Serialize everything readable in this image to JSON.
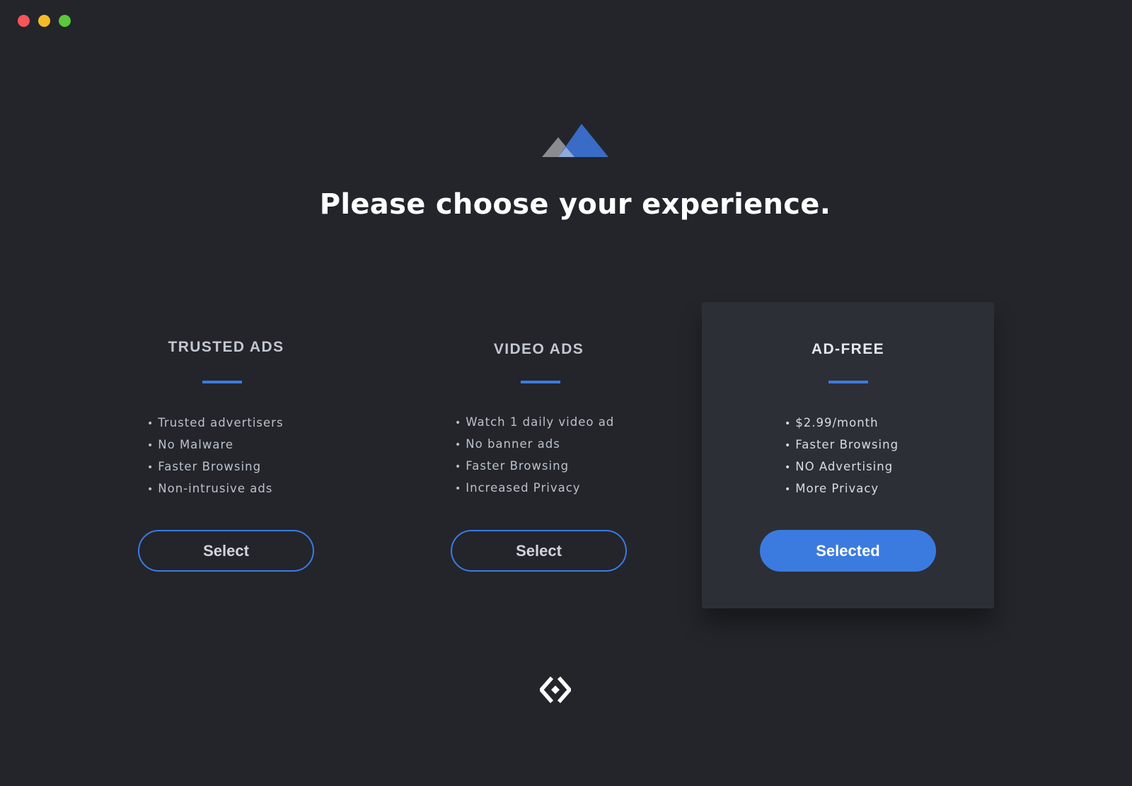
{
  "window": {
    "controls": [
      "close",
      "minimize",
      "zoom"
    ],
    "control_colors": {
      "close": "#f5555b",
      "minimize": "#f5bb26",
      "zoom": "#5cc73a"
    }
  },
  "header": {
    "logo_icon": "mountains-icon",
    "title": "Please choose your experience."
  },
  "plans": [
    {
      "title": "TRUSTED ADS",
      "features": [
        "Trusted advertisers",
        "No Malware",
        "Faster Browsing",
        "Non-intrusive ads"
      ],
      "button_label": "Select",
      "selected": false
    },
    {
      "title": "VIDEO ADS",
      "features": [
        "Watch 1 daily video ad",
        "No banner ads",
        "Faster Browsing",
        "Increased Privacy"
      ],
      "button_label": "Select",
      "selected": false
    },
    {
      "title": "AD-FREE",
      "features": [
        "$2.99/month",
        "Faster Browsing",
        "NO Advertising",
        "More Privacy"
      ],
      "button_label": "Selected",
      "selected": true
    }
  ],
  "footer": {
    "brand_icon": "diamond-brackets-logo-icon"
  },
  "colors": {
    "background": "#23252b",
    "card_selected": "#2d2f36",
    "accent": "#3b7be0",
    "text_primary": "#ffffff",
    "text_muted": "#bcc1ca"
  }
}
